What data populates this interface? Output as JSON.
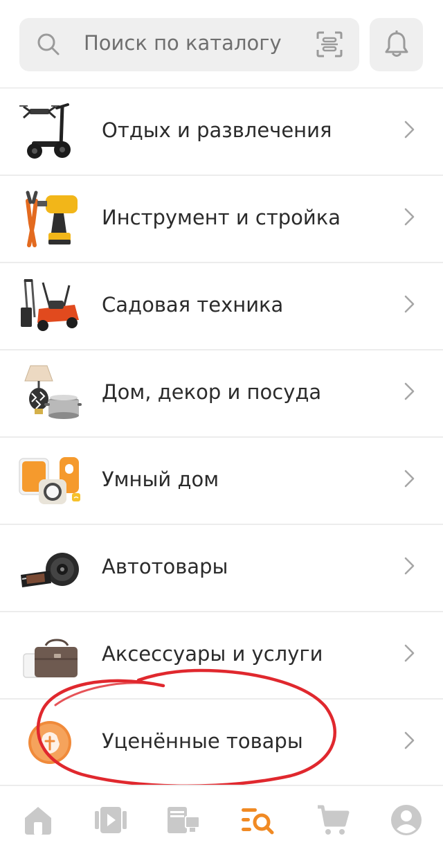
{
  "search": {
    "placeholder": "Поиск по каталогу",
    "icon": "search-icon",
    "scan_icon": "scan-icon"
  },
  "notifications": {
    "icon": "bell-icon"
  },
  "categories": [
    {
      "label": "Отдых и развлечения",
      "icon": "scooter-drone-image"
    },
    {
      "label": "Инструмент и стройка",
      "icon": "drill-pliers-image"
    },
    {
      "label": "Садовая техника",
      "icon": "lawn-mower-image"
    },
    {
      "label": "Дом, декор и посуда",
      "icon": "lamp-pot-image"
    },
    {
      "label": "Умный дом",
      "icon": "smart-home-image"
    },
    {
      "label": "Автотовары",
      "icon": "car-audio-image"
    },
    {
      "label": "Аксессуары и услуги",
      "icon": "bag-accessories-image"
    },
    {
      "label": "Уценённые товары",
      "icon": "discount-badge-image"
    }
  ],
  "bottom_nav": [
    {
      "name": "home",
      "icon": "home-icon",
      "active": false
    },
    {
      "name": "video",
      "icon": "video-icon",
      "active": false
    },
    {
      "name": "devices",
      "icon": "devices-icon",
      "active": false
    },
    {
      "name": "catalog",
      "icon": "catalog-search-icon",
      "active": true
    },
    {
      "name": "cart",
      "icon": "cart-icon",
      "active": false
    },
    {
      "name": "profile",
      "icon": "profile-icon",
      "active": false
    }
  ],
  "colors": {
    "accent": "#f08a24",
    "inactive_icon": "#c9c9c9",
    "annotation": "#e0282e",
    "divider": "#ececec",
    "search_bg": "#efefef"
  }
}
